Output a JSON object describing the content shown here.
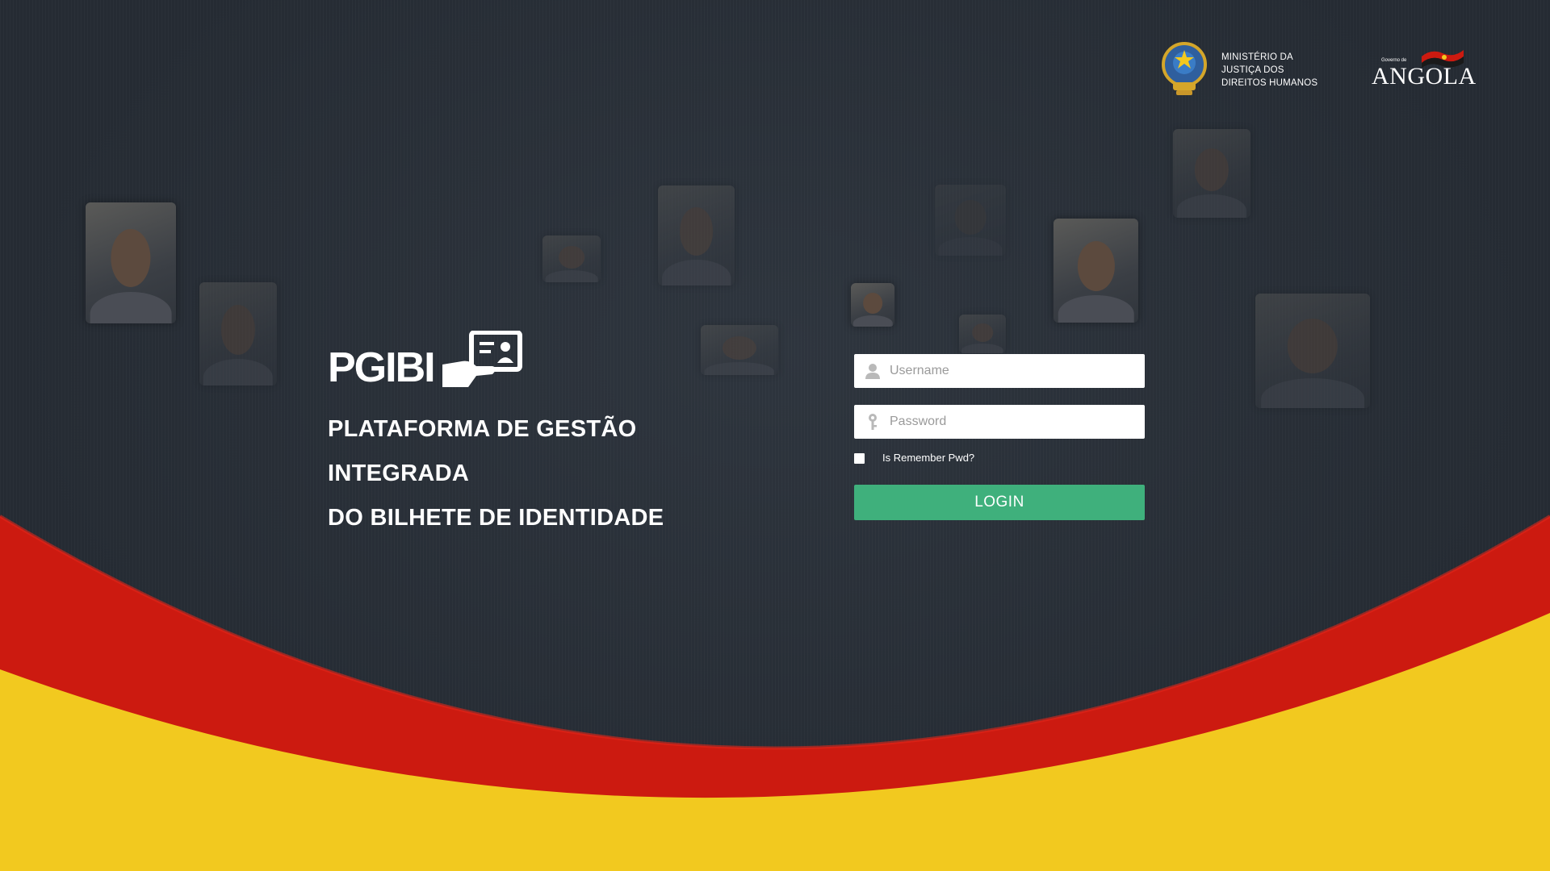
{
  "header": {
    "ministry_lines": [
      "MINISTÉRIO DA",
      "JUSTIÇA DOS",
      "DIREITOS HUMANOS"
    ],
    "government_small": "Governo de",
    "government_word": "ANGOLA"
  },
  "brand": {
    "logo_text": "PGIBI",
    "title_line1": "PLATAFORMA DE GESTÃO INTEGRADA",
    "title_line2": "DO BILHETE DE IDENTIDADE"
  },
  "login": {
    "username_placeholder": "Username",
    "password_placeholder": "Password",
    "remember_label": "Is Remember Pwd?",
    "login_button": "LOGIN"
  },
  "icons": {
    "username": "user-icon",
    "password": "key-icon",
    "emblem": "coat-of-arms-icon",
    "flag": "flag-icon",
    "id-card": "id-card-icon"
  },
  "colors": {
    "background": "#262c34",
    "red_wave": "#cc1a10",
    "yellow_wave": "#f2c91f",
    "login_button": "#3fb07c"
  }
}
